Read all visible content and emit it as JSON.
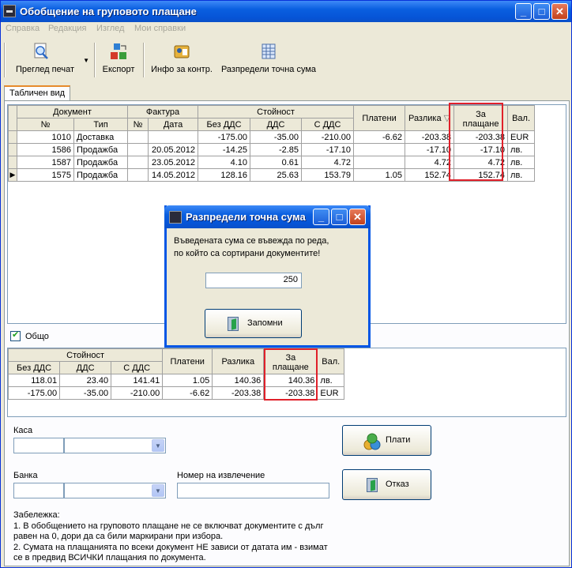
{
  "window": {
    "title": "Обобщение на груповото плащане"
  },
  "menu": [
    "Справка",
    "Редакция",
    "Изглед",
    "Мои справки"
  ],
  "toolbar": {
    "print_preview": "Преглед печат",
    "export": "Експорт",
    "info": "Инфо за контр.",
    "distribute": "Разпредели точна сума"
  },
  "tab": {
    "label": "Табличен вид"
  },
  "grid1": {
    "group_headers": [
      "Документ",
      "Фактура",
      "Стойност",
      "Платени",
      "Разлика",
      "За плащане",
      "Вал."
    ],
    "sub_headers": [
      "№",
      "Тип",
      "№",
      "Дата",
      "Без ДДС",
      "ДДС",
      "С ДДС"
    ],
    "rows": [
      [
        "1010",
        "Доставка",
        "",
        "",
        "-175.00",
        "-35.00",
        "-210.00",
        "-6.62",
        "-203.38",
        "-203.38",
        "EUR"
      ],
      [
        "1586",
        "Продажба",
        "",
        "20.05.2012",
        "-14.25",
        "-2.85",
        "-17.10",
        "",
        "-17.10",
        "-17.10",
        "лв."
      ],
      [
        "1587",
        "Продажба",
        "",
        "23.05.2012",
        "4.10",
        "0.61",
        "4.72",
        "",
        "4.72",
        "4.72",
        "лв."
      ],
      [
        "1575",
        "Продажба",
        "",
        "14.05.2012",
        "128.16",
        "25.63",
        "153.79",
        "1.05",
        "152.74",
        "152.74",
        "лв."
      ]
    ]
  },
  "total_checkbox": {
    "label": "Общо",
    "checked": true
  },
  "grid2": {
    "headers": [
      "Стойност",
      "Платени",
      "Разлика",
      "За плащане",
      "Вал."
    ],
    "sub_headers": [
      "Без ДДС",
      "ДДС",
      "С ДДС"
    ],
    "rows": [
      [
        "118.01",
        "23.40",
        "141.41",
        "1.05",
        "140.36",
        "140.36",
        "лв."
      ],
      [
        "-175.00",
        "-35.00",
        "-210.00",
        "-6.62",
        "-203.38",
        "-203.38",
        "EUR"
      ]
    ]
  },
  "form": {
    "kasa_label": "Каса",
    "banka_label": "Банка",
    "statement_label": "Номер на извлечение",
    "pay_button": "Плати",
    "cancel_button": "Отказ"
  },
  "note": {
    "title": "Забележка:",
    "line1": "1. В обобщението на груповото плащане не се включват документите с дълг",
    "line2": "равен на 0, дори да са били маркирани при избора.",
    "line3": "2. Сумата на плащанията по всеки документ НЕ зависи от датата им - взимат",
    "line4": "се в предвид ВСИЧКИ плащания по документа."
  },
  "dialog": {
    "title": "Разпредели точна сума",
    "message_line1": "Въведената сума се въвежда по реда,",
    "message_line2": "по който са сортирани документите!",
    "amount": "250",
    "save_button": "Запомни"
  },
  "colors": {
    "title_blue": "#0a5fe0",
    "highlight_red": "#e0202a"
  }
}
